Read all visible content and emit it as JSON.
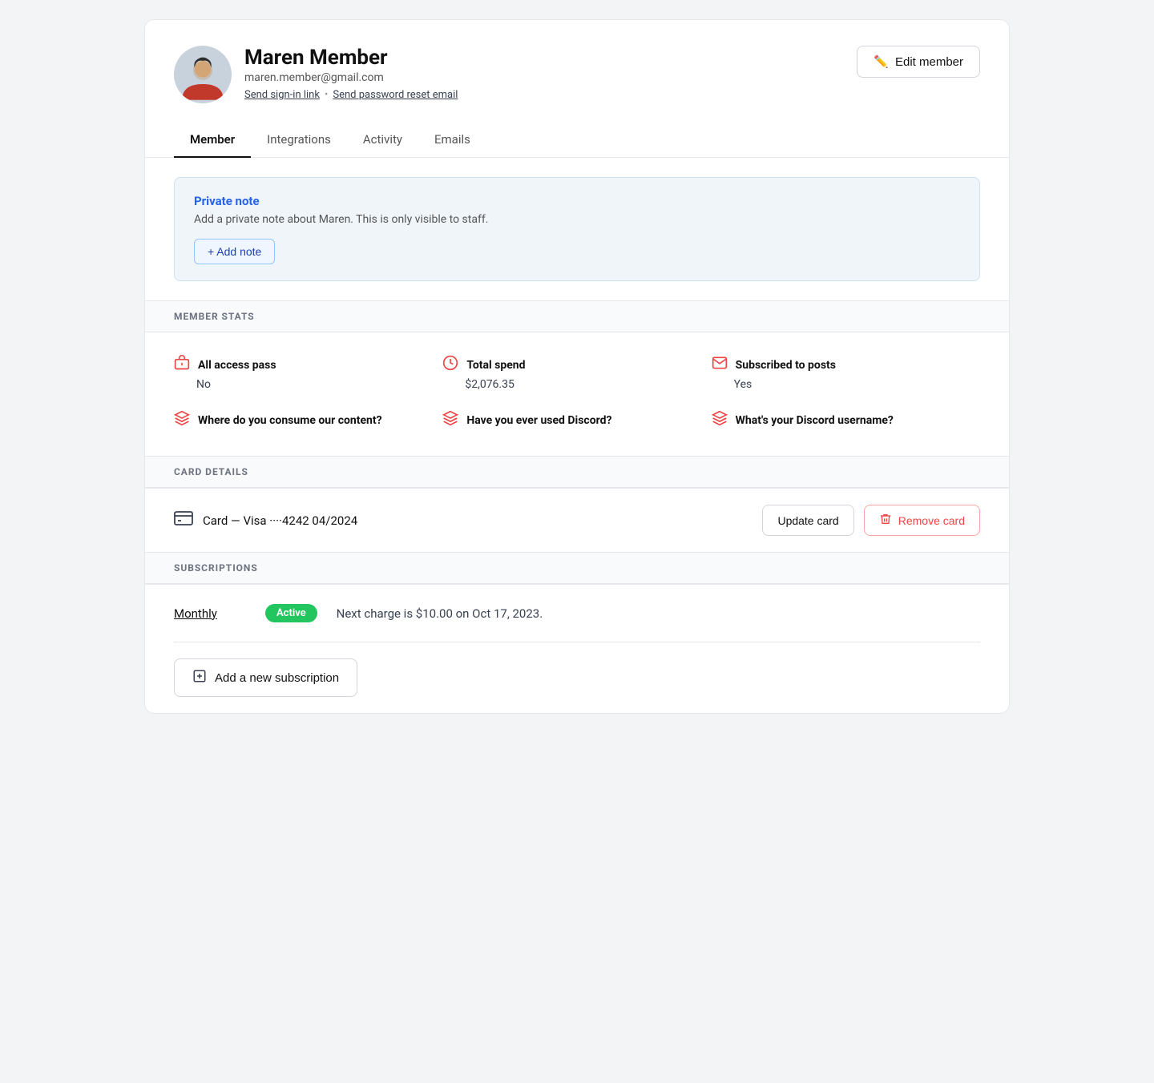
{
  "header": {
    "name": "Maren Member",
    "email": "maren.member@gmail.com",
    "send_signin_label": "Send sign-in link",
    "dot": "•",
    "send_reset_label": "Send password reset email",
    "edit_button_label": "Edit member"
  },
  "tabs": [
    {
      "label": "Member",
      "active": true
    },
    {
      "label": "Integrations",
      "active": false
    },
    {
      "label": "Activity",
      "active": false
    },
    {
      "label": "Emails",
      "active": false
    }
  ],
  "private_note": {
    "title": "Private note",
    "description": "Add a private note about Maren. This is only visible to staff.",
    "add_button_label": "+ Add note"
  },
  "member_stats": {
    "section_label": "MEMBER STATS",
    "items": [
      {
        "label": "All access pass",
        "value": "No"
      },
      {
        "label": "Total spend",
        "value": "$2,076.35"
      },
      {
        "label": "Subscribed to posts",
        "value": "Yes"
      },
      {
        "label": "Where do you consume our content?",
        "value": ""
      },
      {
        "label": "Have you ever used Discord?",
        "value": ""
      },
      {
        "label": "What's your Discord username?",
        "value": ""
      }
    ]
  },
  "card_details": {
    "section_label": "CARD DETAILS",
    "card_text": "Card — Visa ····4242  04/2024",
    "update_button": "Update card",
    "remove_button": "Remove card"
  },
  "subscriptions": {
    "section_label": "SUBSCRIPTIONS",
    "items": [
      {
        "name": "Monthly",
        "status": "Active",
        "description": "Next charge is $10.00 on  Oct 17, 2023."
      }
    ],
    "add_button": "Add a new subscription"
  }
}
